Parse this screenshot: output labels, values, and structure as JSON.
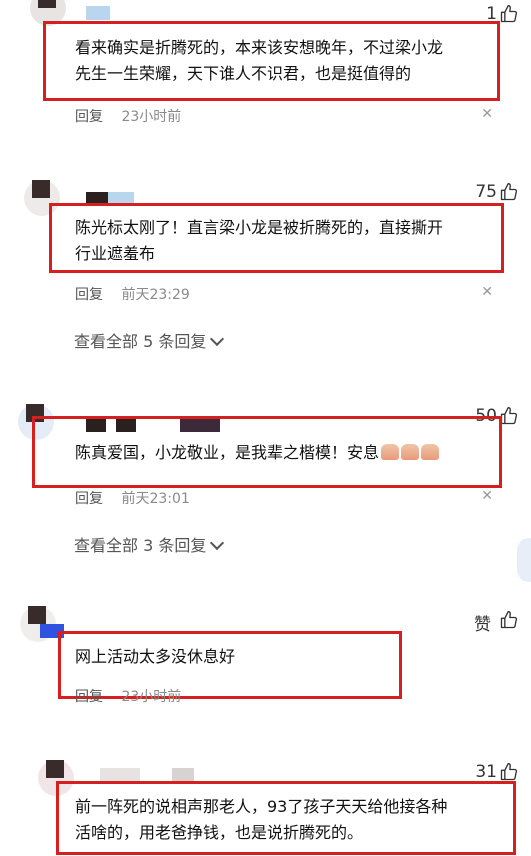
{
  "comments": [
    {
      "likes": "1",
      "text": "看来确实是折腾死的，本来该安想晚年，不过梁小龙先生一生荣耀，天下谁人不识君，也是挺值得的",
      "text_line1": "看来确实是折腾死的，本来该安想晚年，不过梁小龙",
      "text_line2": "先生一生荣耀，天下谁人不识君，也是挺值得的",
      "reply_label": "回复",
      "time": "23小时前"
    },
    {
      "likes": "75",
      "text_line1": "陈光标太刚了！直言梁小龙是被折腾死的，直接撕开",
      "text_line2": "行业遮羞布",
      "reply_label": "回复",
      "time": "前天23:29",
      "view_all": "查看全部 5 条回复"
    },
    {
      "likes": "50",
      "text_line1": "陈真爱国，小龙敬业，是我辈之楷模！安息",
      "reply_label": "回复",
      "time": "前天23:01",
      "view_all": "查看全部 3 条回复"
    },
    {
      "likes": "赞",
      "text_line1": "网上活动太多没休息好",
      "reply_label": "回复",
      "time": "23小时前"
    },
    {
      "likes": "31",
      "text_line1": "前一阵死的说相声那老人，93了孩子天天给他接各种",
      "text_line2": "活啥的，用老爸挣钱，也是说折腾死的。"
    }
  ],
  "icons": {
    "thumb": "thumb-up-icon",
    "close": "close-icon",
    "chevron": "chevron-down-icon",
    "emoji": "praying-hands-emoji"
  },
  "colors": {
    "highlight": "#d61f1f",
    "muted": "#8a8a8a"
  }
}
